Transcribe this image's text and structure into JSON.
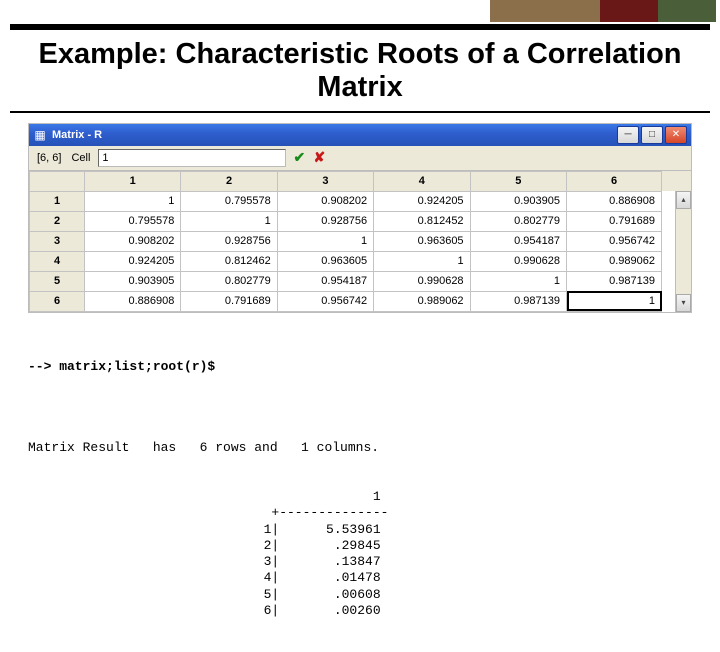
{
  "title": "Example: Characteristic Roots of a Correlation Matrix",
  "window": {
    "caption": "Matrix - R",
    "dim": "[6, 6]",
    "cell_label": "Cell",
    "cell_value": "1"
  },
  "matrix": {
    "col_headers": [
      "1",
      "2",
      "3",
      "4",
      "5",
      "6"
    ],
    "row_headers": [
      "1",
      "2",
      "3",
      "4",
      "5",
      "6"
    ],
    "cells": [
      [
        "1",
        "0.795578",
        "0.908202",
        "0.924205",
        "0.903905",
        "0.886908"
      ],
      [
        "0.795578",
        "1",
        "0.928756",
        "0.812452",
        "0.802779",
        "0.791689"
      ],
      [
        "0.908202",
        "0.928756",
        "1",
        "0.963605",
        "0.954187",
        "0.956742"
      ],
      [
        "0.924205",
        "0.812462",
        "0.963605",
        "1",
        "0.990628",
        "0.989062"
      ],
      [
        "0.903905",
        "0.802779",
        "0.954187",
        "0.990628",
        "1",
        "0.987139"
      ],
      [
        "0.886908",
        "0.791689",
        "0.956742",
        "0.989062",
        "0.987139",
        "1"
      ]
    ]
  },
  "console": {
    "cmd": "--> matrix;list;root(r)$",
    "msg": "Matrix Result   has   6 rows and   1 columns.",
    "chart_data": {
      "type": "table",
      "title": "root(r)",
      "categories": [
        "1",
        "2",
        "3",
        "4",
        "5",
        "6"
      ],
      "col_header": "1",
      "values": [
        5.53961,
        0.29845,
        0.13847,
        0.01478,
        0.00608,
        0.0026
      ]
    },
    "lines": [
      "                1",
      "   +--------------",
      "  1|      5.53961",
      "  2|       .29845",
      "  3|       .13847",
      "  4|       .01478",
      "  5|       .00608",
      "  6|       .00260"
    ]
  }
}
